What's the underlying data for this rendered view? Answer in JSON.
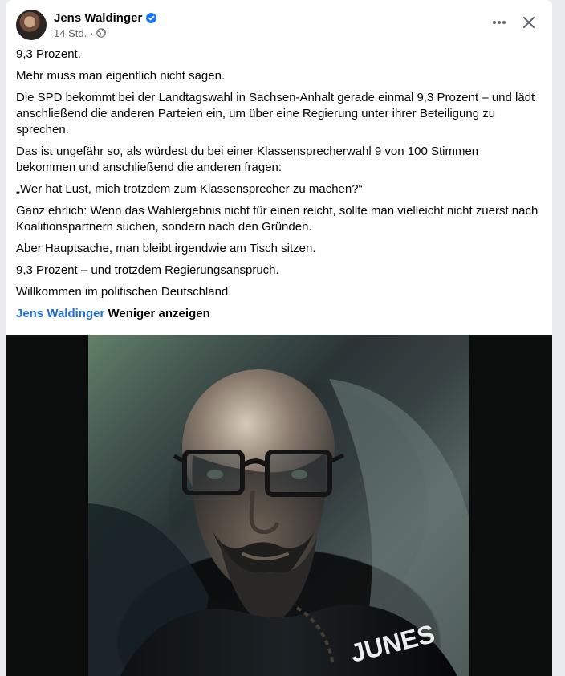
{
  "post": {
    "author": "Jens Waldinger",
    "timestamp": "14 Std.",
    "separator": "·",
    "paragraphs": [
      "9,3 Prozent.",
      "Mehr muss man eigentlich nicht sagen.",
      "Die SPD bekommt bei der Landtagswahl in Sachsen-Anhalt gerade einmal 9,3 Prozent – und lädt anschließend die anderen Parteien ein, um über eine Regierung unter ihrer Beteiligung zu sprechen.",
      "Das ist ungefähr so, als würdest du bei einer Klassensprecherwahl 9 von 100 Stimmen bekommen und anschließend die anderen fragen:",
      "„Wer hat Lust, mich trotzdem zum Klassensprecher zu machen?“",
      "Ganz ehrlich: Wenn das Wahlergebnis nicht für einen reicht, sollte man vielleicht nicht zuerst nach Koalitionspartnern suchen, sondern nach den Gründen.",
      "Aber Hauptsache, man bleibt irgendwie am Tisch sitzen.",
      "9,3 Prozent – und trotzdem Regierungsanspruch.",
      "Willkommen im politischen Deutschland."
    ],
    "author_link": "Jens Waldinger",
    "show_less": "Weniger anzeigen",
    "photo_text": "JUNES"
  },
  "icons": {
    "verified": "verified-badge-icon",
    "privacy": "globe-icon",
    "more": "more-options-icon",
    "close": "close-icon"
  },
  "colors": {
    "accent_blue": "#216fdb",
    "verified_blue": "#1877f2",
    "meta_gray": "#65676b"
  }
}
